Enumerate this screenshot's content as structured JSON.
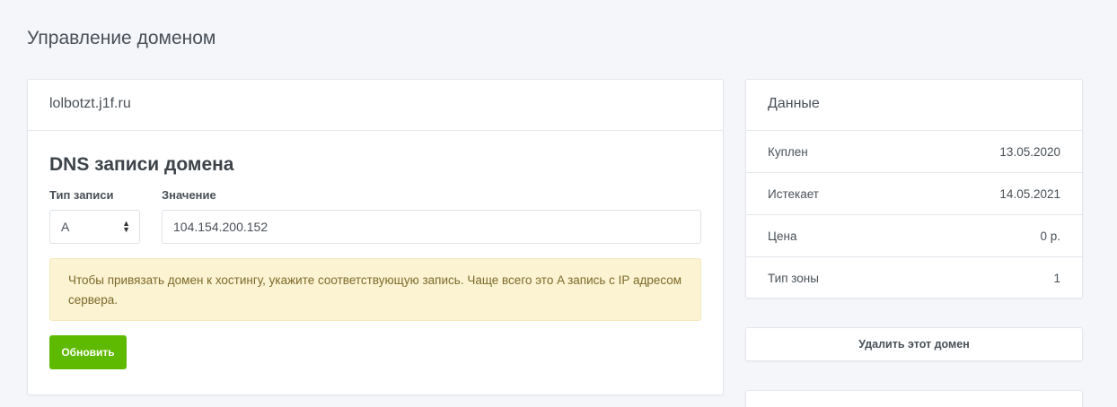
{
  "page": {
    "title": "Управление доменом"
  },
  "domain_card": {
    "domain": "lolbotzt.j1f.ru",
    "section_title": "DNS записи домена",
    "record_type_label": "Тип записи",
    "record_type_value": "A",
    "value_label": "Значение",
    "value": "104.154.200.152",
    "alert_text": "Чтобы привязать домен к хостингу, укажите соответствующую запись. Чаще всего это A запись с IP адресом сервера.",
    "update_button": "Обновить"
  },
  "data_card": {
    "title": "Данные",
    "rows": [
      {
        "label": "Куплен",
        "value": "13.05.2020"
      },
      {
        "label": "Истекает",
        "value": "14.05.2021"
      },
      {
        "label": "Цена",
        "value": "0 р."
      },
      {
        "label": "Тип зоны",
        "value": "1"
      }
    ]
  },
  "delete_button": "Удалить этот домен",
  "colors": {
    "accent_green": "#5eba00",
    "alert_bg": "#fbf3d2",
    "page_bg": "#f5f6fa"
  }
}
